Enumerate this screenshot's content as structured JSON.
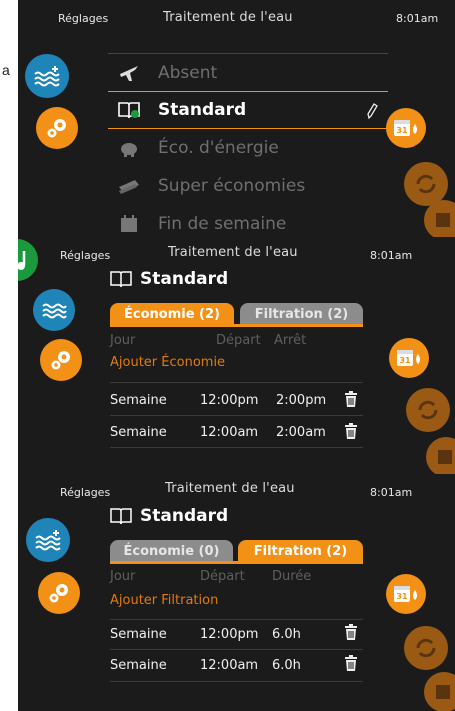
{
  "edge_char": "a",
  "status": {
    "left": "Réglages",
    "title": "Traitement de l'eau",
    "time": "8:01am"
  },
  "menu": {
    "items": [
      {
        "label": "Absent",
        "icon": "plane-icon"
      },
      {
        "label": "Standard",
        "icon": "book-icon"
      },
      {
        "label": "Éco. d'énergie",
        "icon": "piggy-bank-icon"
      },
      {
        "label": "Super économies",
        "icon": "money-icon"
      },
      {
        "label": "Fin de semaine",
        "icon": "calendar-icon"
      }
    ],
    "selected": "Standard"
  },
  "program_title": "Standard",
  "economy_screen": {
    "tabs": {
      "economy": "Économie (2)",
      "filtration": "Filtration (2)",
      "active": "economy"
    },
    "columns": [
      "Jour",
      "Départ",
      "Arrêt"
    ],
    "add_label": "Ajouter Économie",
    "rows": [
      {
        "day": "Semaine",
        "start": "12:00pm",
        "end": "2:00pm"
      },
      {
        "day": "Semaine",
        "start": "12:00am",
        "end": "2:00am"
      }
    ]
  },
  "filtration_screen": {
    "tabs": {
      "economy": "Économie (0)",
      "filtration": "Filtration (2)",
      "active": "filtration"
    },
    "columns": [
      "Jour",
      "Départ",
      "Durée"
    ],
    "add_label": "Ajouter Filtration",
    "rows": [
      {
        "day": "Semaine",
        "start": "12:00pm",
        "duration": "6.0h"
      },
      {
        "day": "Semaine",
        "start": "12:00am",
        "duration": "6.0h"
      }
    ]
  },
  "calendar_day": "31",
  "colors": {
    "accent": "#f29115",
    "blue": "#1f84b8",
    "panel": "#1b1b1b",
    "green": "#1a9a3d"
  }
}
